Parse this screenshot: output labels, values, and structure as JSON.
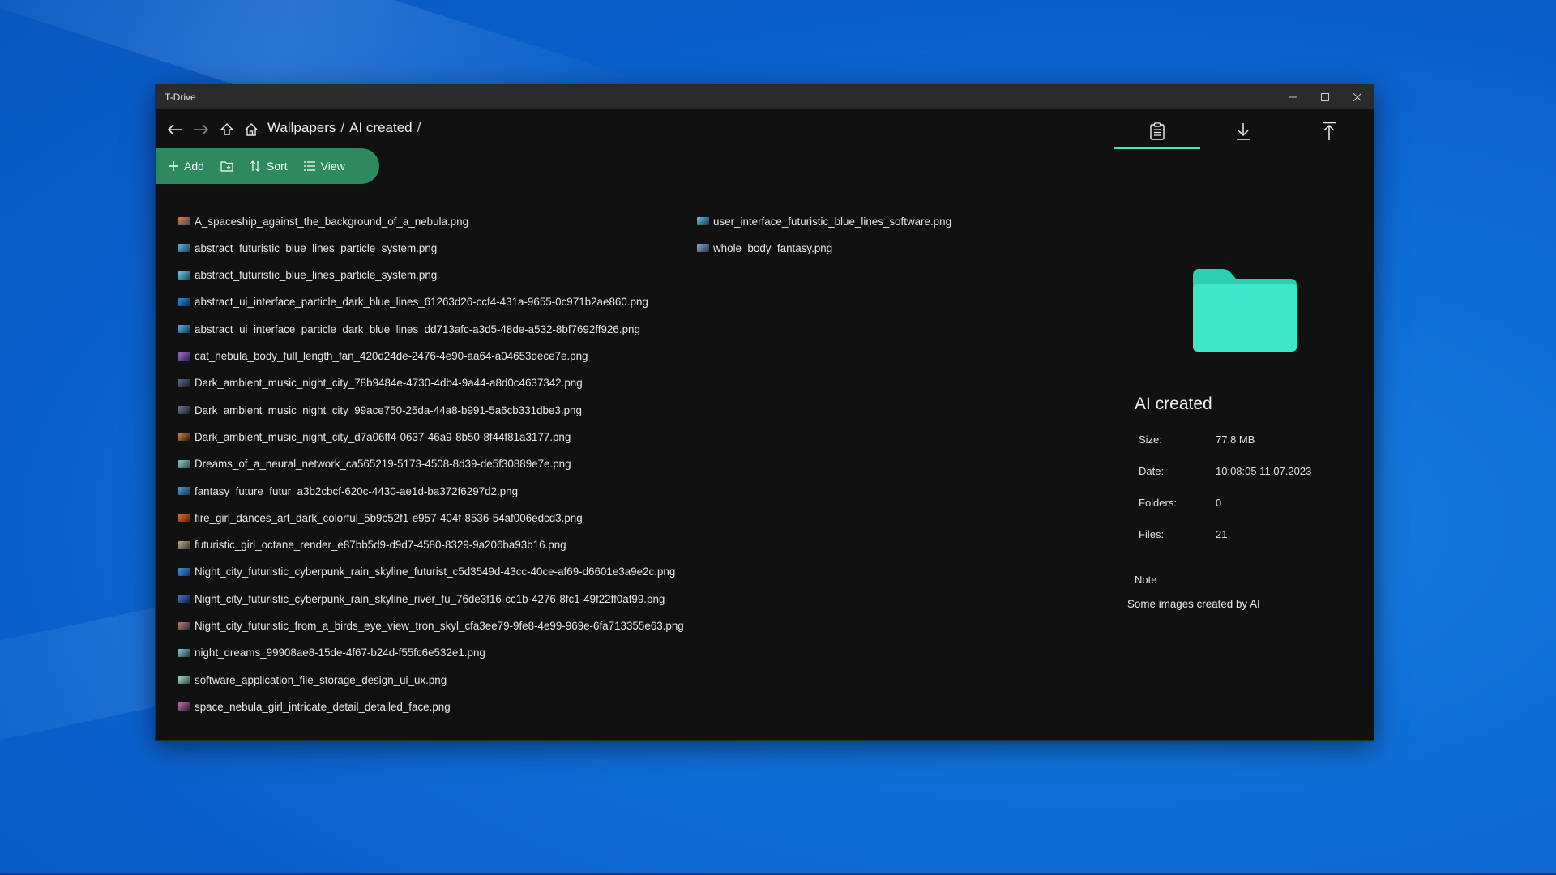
{
  "window": {
    "title": "T-Drive"
  },
  "breadcrumb": {
    "parts": [
      "Wallpapers",
      "AI created"
    ],
    "separator": "/"
  },
  "toolbar": {
    "add_label": "Add",
    "sort_label": "Sort",
    "view_label": "View"
  },
  "files_left": [
    {
      "name": "A_spaceship_against_the_background_of_a_nebula.png",
      "c1": "#e27a2b",
      "c2": "#3a4a7a"
    },
    {
      "name": "abstract_futuristic_blue_lines_particle_system.png",
      "c1": "#5fb8e0",
      "c2": "#1d3a5a"
    },
    {
      "name": "abstract_futuristic_blue_lines_particle_system.png",
      "c1": "#6ccbe8",
      "c2": "#204060"
    },
    {
      "name": "abstract_ui_interface_particle_dark_blue_lines_61263d26-ccf4-431a-9655-0c971b2ae860.png",
      "c1": "#2d8ee8",
      "c2": "#0c2a4a"
    },
    {
      "name": "abstract_ui_interface_particle_dark_blue_lines_dd713afc-a3d5-48de-a532-8bf7692ff926.png",
      "c1": "#5ab0e8",
      "c2": "#163450"
    },
    {
      "name": "cat_nebula_body_full_length_fan_420d24de-2476-4e90-aa64-a04653dece7e.png",
      "c1": "#a070d8",
      "c2": "#2a1a4a"
    },
    {
      "name": "Dark_ambient_music_night_city_78b9484e-4730-4db4-9a44-a8d0c4637342.png",
      "c1": "#5a6a8a",
      "c2": "#1a1a2a"
    },
    {
      "name": "Dark_ambient_music_night_city_99ace750-25da-44a8-b991-5a6cb331dbe3.png",
      "c1": "#6a7a9a",
      "c2": "#15182a"
    },
    {
      "name": "Dark_ambient_music_night_city_d7a06ff4-0637-46a9-8b50-8f44f81a3177.png",
      "c1": "#d88a3a",
      "c2": "#201820"
    },
    {
      "name": "Dreams_of_a_neural_network_ca565219-5173-4508-8d39-de5f30889e7e.png",
      "c1": "#8ac8c0",
      "c2": "#2a4a48"
    },
    {
      "name": "fantasy_future_futur_a3b2cbcf-620c-4430-ae1d-ba372f6297d2.png",
      "c1": "#4aa0d8",
      "c2": "#1a3048"
    },
    {
      "name": "fire_girl_dances_art_dark_colorful_5b9c52f1-e957-404f-8536-54af006edcd3.png",
      "c1": "#e8702a",
      "c2": "#5a1a10"
    },
    {
      "name": "futuristic_girl_octane_render_e87bb5d9-d9d7-4580-8329-9a206ba93b16.png",
      "c1": "#b8a890",
      "c2": "#403028"
    },
    {
      "name": "Night_city_futuristic_cyberpunk_rain_skyline_futurist_c5d3549d-43cc-40ce-af69-d6601e3a9e2c.png",
      "c1": "#3a9ae8",
      "c2": "#1a2a58"
    },
    {
      "name": "Night_city_futuristic_cyberpunk_rain_skyline_river_fu_76de3f16-cc1b-4276-8fc1-49f22ff0af99.png",
      "c1": "#4a7ac8",
      "c2": "#101a30"
    },
    {
      "name": "Night_city_futuristic_from_a_birds_eye_view_tron_skyl_cfa3ee79-9fe8-4e99-969e-6fa713355e63.png",
      "c1": "#c07a6a",
      "c2": "#202a40"
    },
    {
      "name": "night_dreams_99908ae8-15de-4f67-b24d-f55fc6e532e1.png",
      "c1": "#8ac8d8",
      "c2": "#203040"
    },
    {
      "name": "software_application_file_storage_design_ui_ux.png",
      "c1": "#a8e0c8",
      "c2": "#2a4a40"
    },
    {
      "name": "space_nebula_girl_intricate_detail_detailed_face.png",
      "c1": "#c86aa8",
      "c2": "#2a1838"
    }
  ],
  "files_right": [
    {
      "name": "user_interface_futuristic_blue_lines_software.png",
      "c1": "#5ac0e8",
      "c2": "#1a3a58"
    },
    {
      "name": "whole_body_fantasy.png",
      "c1": "#8aa8c8",
      "c2": "#2a3a50"
    }
  ],
  "info": {
    "title": "AI created",
    "size_label": "Size:",
    "size_value": "77.8 MB",
    "date_label": "Date:",
    "date_value": "10:08:05 11.07.2023",
    "folders_label": "Folders:",
    "folders_value": "0",
    "files_label": "Files:",
    "files_value": "21",
    "note_label": "Note",
    "note_text": "Some images created by AI"
  },
  "colors": {
    "accent": "#3ee8b8",
    "toolbar_bg": "#2d8a5e",
    "folder": "#35e0c0",
    "window_bg": "#111111",
    "titlebar_bg": "#2b2b2b"
  },
  "icons": [
    "back-arrow-icon",
    "forward-arrow-icon",
    "up-folder-icon",
    "home-icon",
    "plus-icon",
    "new-folder-icon",
    "sort-icon",
    "list-view-icon",
    "clipboard-icon",
    "download-icon",
    "upload-icon",
    "minimize-icon",
    "maximize-icon",
    "close-icon",
    "folder-icon"
  ]
}
